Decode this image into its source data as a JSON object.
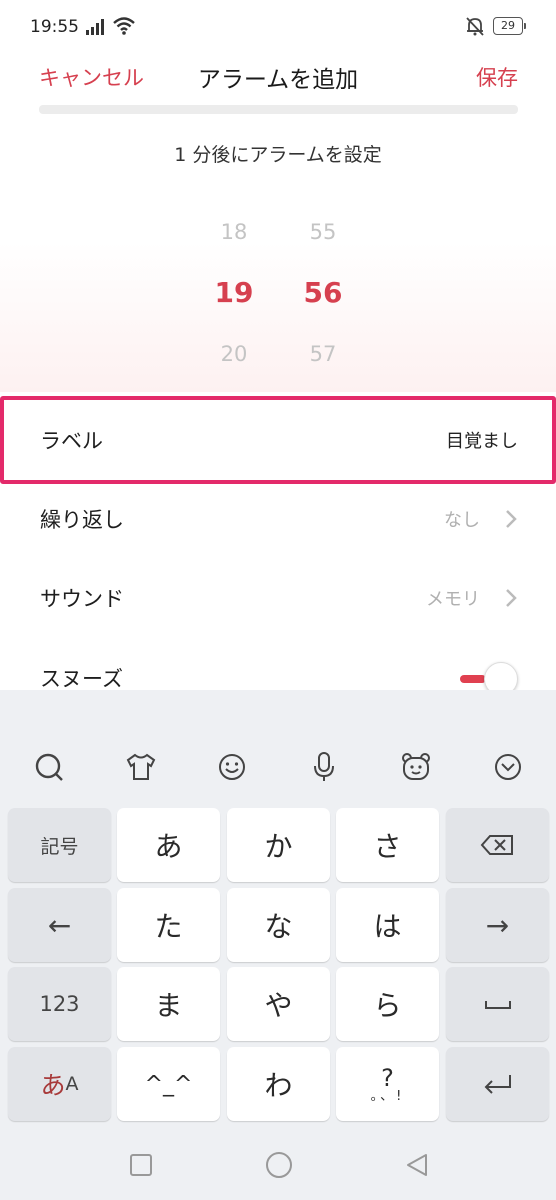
{
  "status_bar": {
    "time": "19:55",
    "battery": "29"
  },
  "header": {
    "cancel_label": "キャンセル",
    "title": "アラームを追加",
    "save_label": "保存"
  },
  "picker": {
    "subtitle": "1 分後にアラームを設定",
    "hours": {
      "prev": "18",
      "selected": "19",
      "next": "20"
    },
    "minutes": {
      "prev": "55",
      "selected": "56",
      "next": "57"
    }
  },
  "settings": {
    "label": {
      "title": "ラベル",
      "value": "目覚まし"
    },
    "repeat": {
      "title": "繰り返し",
      "value": "なし"
    },
    "sound": {
      "title": "サウンド",
      "value": "メモリ"
    },
    "snooze": {
      "title": "スヌーズ",
      "enabled": true
    }
  },
  "keyboard": {
    "toolbar_icons": [
      "search-bubble-icon",
      "shirt-icon",
      "smiley-icon",
      "microphone-icon",
      "bear-icon",
      "collapse-chevron-icon"
    ],
    "rows": [
      [
        "記号",
        "あ",
        "か",
        "さ",
        "backspace"
      ],
      [
        "←",
        "た",
        "な",
        "は",
        "→"
      ],
      [
        "123",
        "ま",
        "や",
        "ら",
        "space"
      ],
      [
        "あA",
        "^_^",
        "わ",
        "?。、!",
        "enter"
      ]
    ],
    "keys": {
      "symbols": "記号",
      "a": "あ",
      "ka": "か",
      "sa": "さ",
      "left": "←",
      "ta": "た",
      "na": "な",
      "ha": "は",
      "right": "→",
      "num": "123",
      "ma": "ま",
      "ya": "や",
      "ra": "ら",
      "mode_hira": "あ",
      "mode_latin": "A",
      "emoticon": "^_^",
      "wa": "わ",
      "punct_q": "?",
      "punct_rest": "。、!"
    }
  },
  "colors": {
    "accent": "#d6404f",
    "highlight_border": "#e32a6a",
    "keyboard_bg": "#eef0f3"
  }
}
